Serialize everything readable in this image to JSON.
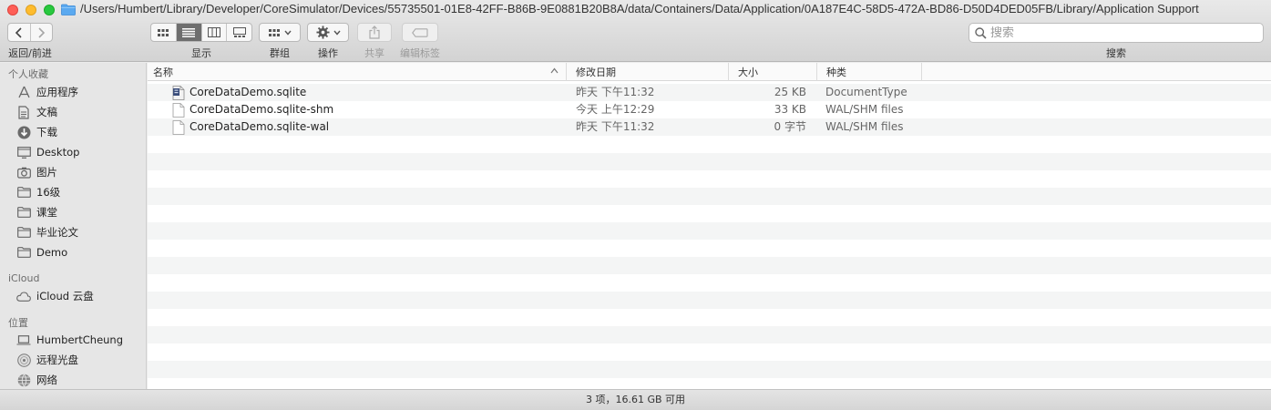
{
  "window": {
    "path": "/Users/Humbert/Library/Developer/CoreSimulator/Devices/55735501-01E8-42FF-B86B-9E0881B20B8A/data/Containers/Data/Application/0A187E4C-58D5-472A-BD86-D50D4DED05FB/Library/Application Support"
  },
  "toolbar": {
    "nav_label": "返回/前进",
    "view_label": "显示",
    "group_label": "群组",
    "action_label": "操作",
    "share_label": "共享",
    "tags_label": "编辑标签",
    "search_label": "搜索",
    "search_placeholder": "搜索"
  },
  "sidebar": {
    "favorites_header": "个人收藏",
    "favorites": [
      {
        "label": "应用程序",
        "icon": "applications-icon"
      },
      {
        "label": "文稿",
        "icon": "documents-icon"
      },
      {
        "label": "下载",
        "icon": "downloads-icon"
      },
      {
        "label": "Desktop",
        "icon": "desktop-icon"
      },
      {
        "label": "图片",
        "icon": "pictures-icon"
      },
      {
        "label": "16级",
        "icon": "folder-icon"
      },
      {
        "label": "课堂",
        "icon": "folder-icon"
      },
      {
        "label": "毕业论文",
        "icon": "folder-icon"
      },
      {
        "label": "Demo",
        "icon": "folder-icon"
      }
    ],
    "icloud_header": "iCloud",
    "icloud": [
      {
        "label": "iCloud 云盘",
        "icon": "cloud-icon"
      }
    ],
    "locations_header": "位置",
    "locations": [
      {
        "label": "HumbertCheung",
        "icon": "laptop-icon"
      },
      {
        "label": "远程光盘",
        "icon": "disc-icon"
      },
      {
        "label": "网络",
        "icon": "network-icon"
      }
    ]
  },
  "list": {
    "columns": {
      "name": "名称",
      "date": "修改日期",
      "size": "大小",
      "kind": "种类"
    },
    "files": [
      {
        "name": "CoreDataDemo.sqlite",
        "date": "昨天 下午11:32",
        "size": "25 KB",
        "kind": "DocumentType",
        "icon": "sqlite-file-icon"
      },
      {
        "name": "CoreDataDemo.sqlite-shm",
        "date": "今天 上午12:29",
        "size": "33 KB",
        "kind": "WAL/SHM files",
        "icon": "document-icon"
      },
      {
        "name": "CoreDataDemo.sqlite-wal",
        "date": "昨天 下午11:32",
        "size": "0 字节",
        "kind": "WAL/SHM files",
        "icon": "document-icon"
      }
    ]
  },
  "status": {
    "text": "3 项，16.61 GB 可用"
  }
}
